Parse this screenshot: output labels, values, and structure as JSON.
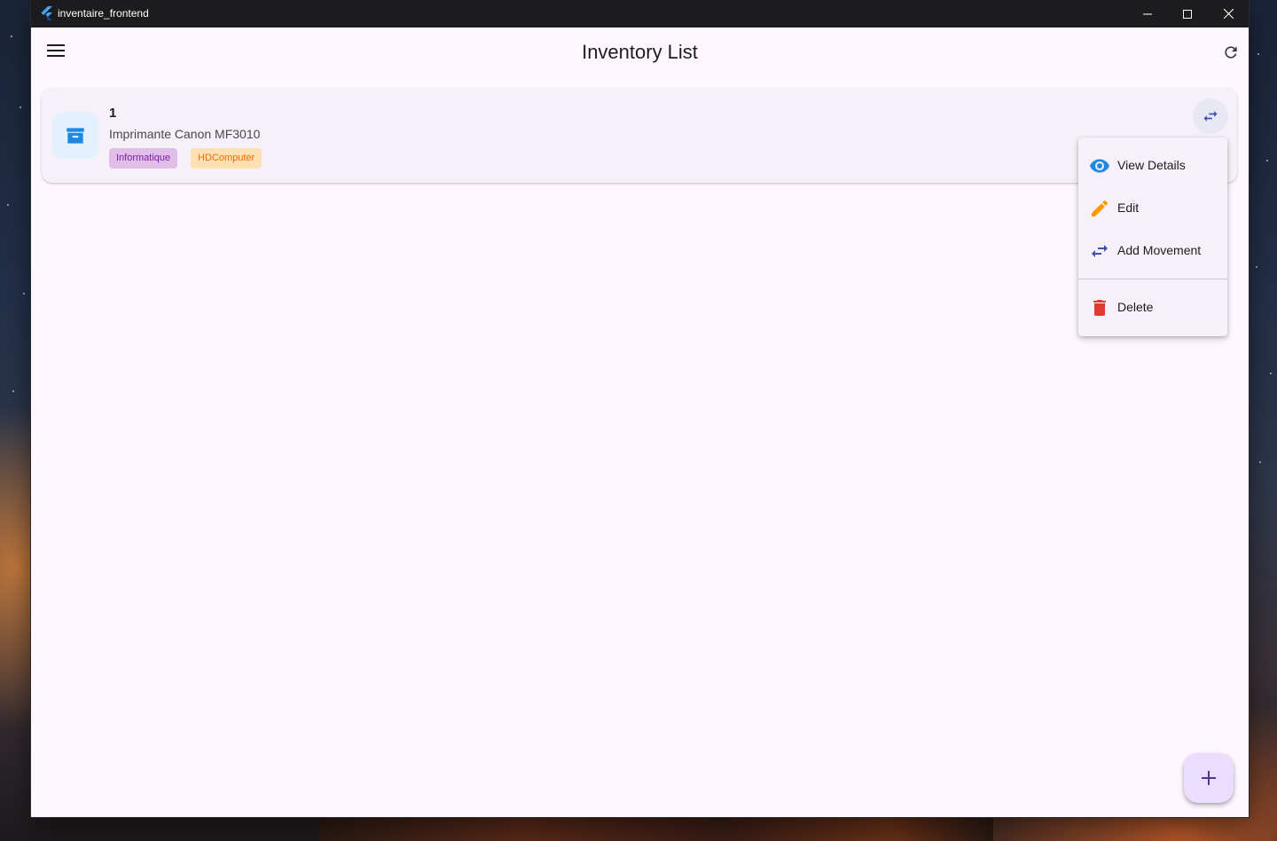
{
  "window": {
    "title": "inventaire_frontend",
    "controls": [
      "minimize-icon",
      "maximize-icon",
      "close-icon"
    ]
  },
  "appbar": {
    "title": "Inventory List",
    "left_icon": "menu-icon",
    "right_icon": "refresh-icon"
  },
  "items": [
    {
      "number": "1",
      "name": "Imprimante Canon MF3010",
      "category": "Informatique",
      "location": "HDComputer",
      "icon": "inventory-box-icon",
      "action_icon": "swap-horiz-icon"
    }
  ],
  "context_menu": {
    "items": [
      {
        "label": "View Details",
        "icon": "eye-icon",
        "color": "#1e88e5"
      },
      {
        "label": "Edit",
        "icon": "pencil-icon",
        "color": "#ff9800"
      },
      {
        "label": "Add Movement",
        "icon": "swap-horiz-icon",
        "color": "#3f51b5"
      },
      {
        "label": "Delete",
        "icon": "trash-icon",
        "color": "#e53935"
      }
    ]
  },
  "fab": {
    "icon": "add-icon"
  },
  "colors": {
    "surface": "#fef7ff",
    "card": "#f6f1f8",
    "category_chip_bg": "#e1bee7",
    "category_chip_fg": "#7b1fa2",
    "location_chip_bg": "#ffe0b2",
    "location_chip_fg": "#ef6c00",
    "fab_bg": "#eaddff",
    "primary": "#6750a4"
  }
}
